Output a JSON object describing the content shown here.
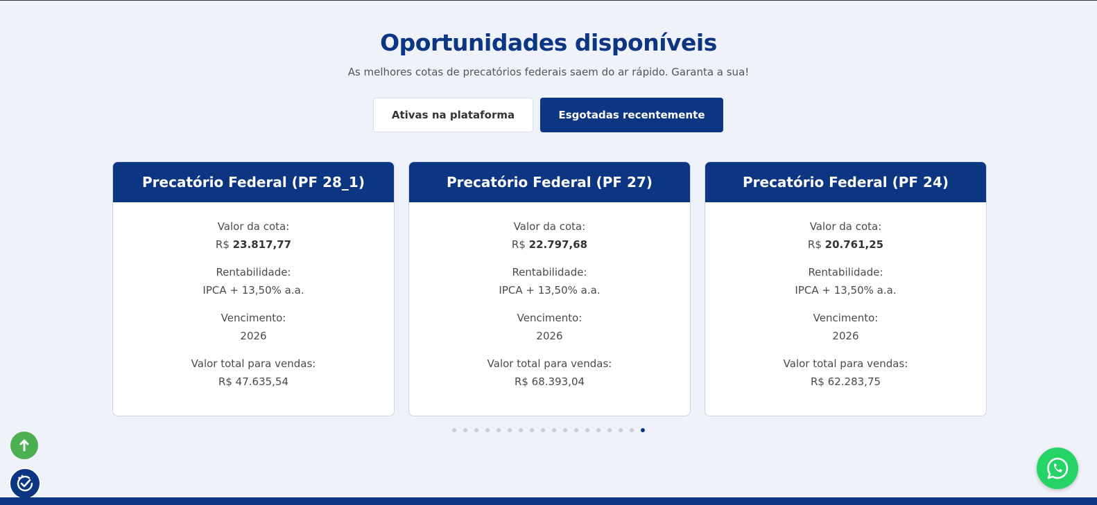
{
  "section": {
    "title": "Oportunidades disponíveis",
    "subtitle": "As melhores cotas de precatórios federais saem do ar rápido. Garanta a sua!"
  },
  "tabs": [
    {
      "label": "Ativas na plataforma",
      "active": false
    },
    {
      "label": "Esgotadas recentemente",
      "active": true
    }
  ],
  "cards": [
    {
      "title": "Precatório Federal (PF 28_1)",
      "quota_label": "Valor da cota:",
      "quota_currency": "R$",
      "quota_value": "23.817,77",
      "yield_label": "Rentabilidade:",
      "yield_value": "IPCA + 13,50% a.a.",
      "maturity_label": "Vencimento:",
      "maturity_value": "2026",
      "total_label": "Valor total para vendas:",
      "total_value": "R$ 47.635,54"
    },
    {
      "title": "Precatório Federal (PF 27)",
      "quota_label": "Valor da cota:",
      "quota_currency": "R$",
      "quota_value": "22.797,68",
      "yield_label": "Rentabilidade:",
      "yield_value": "IPCA + 13,50% a.a.",
      "maturity_label": "Vencimento:",
      "maturity_value": "2026",
      "total_label": "Valor total para vendas:",
      "total_value": "R$ 68.393,04"
    },
    {
      "title": "Precatório Federal (PF 24)",
      "quota_label": "Valor da cota:",
      "quota_currency": "R$",
      "quota_value": "20.761,25",
      "yield_label": "Rentabilidade:",
      "yield_value": "IPCA + 13,50% a.a.",
      "maturity_label": "Vencimento:",
      "maturity_value": "2026",
      "total_label": "Valor total para vendas:",
      "total_value": "R$ 62.283,75"
    }
  ],
  "pagination": {
    "total": 18,
    "active_index": 17
  },
  "icons": {
    "scroll_top": "arrow-up-icon",
    "accessibility": "check-badge-icon",
    "chat": "whatsapp-icon"
  },
  "colors": {
    "brand": "#0c3582",
    "background": "#f0f2f9",
    "whatsapp": "#25d366",
    "scroll_top": "#4caf50"
  }
}
